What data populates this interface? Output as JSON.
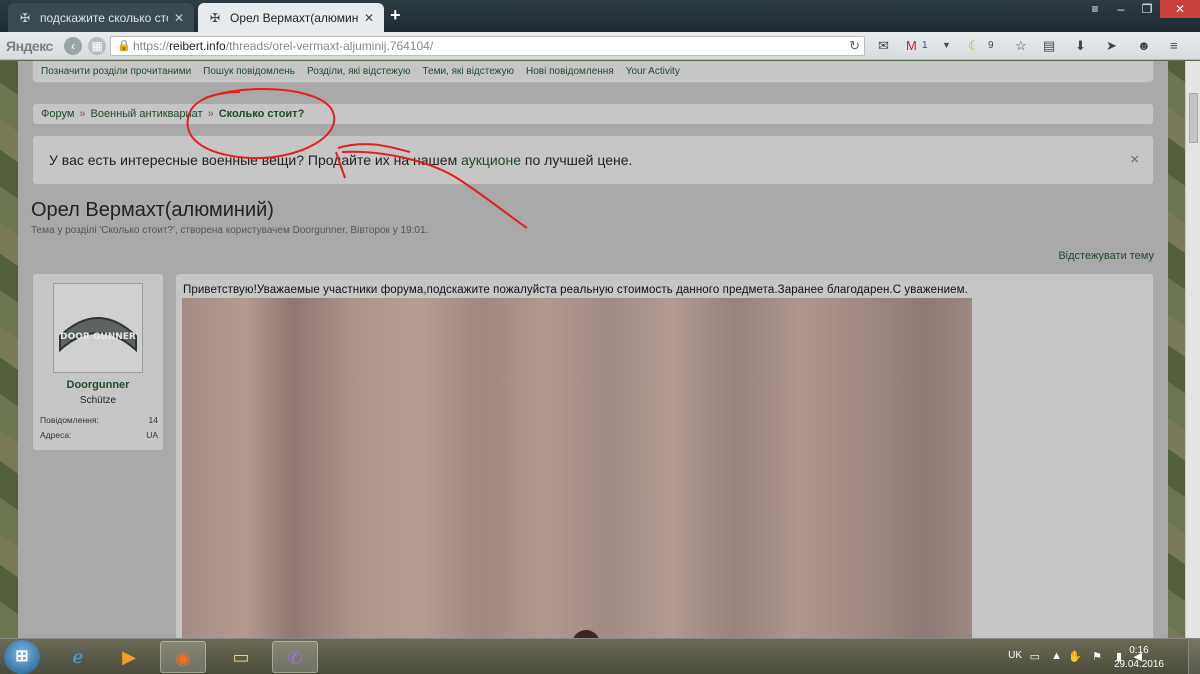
{
  "browser": {
    "tabs": [
      {
        "title": "подскажите сколько стои…",
        "active": false
      },
      {
        "title": "Орел Вермахт(алюминий…",
        "active": true
      }
    ],
    "brand": "Яндекс",
    "url_prefix": "https://",
    "url_host": "reibert.info",
    "url_path": "/threads/orel-vermaxt-aljuminij.764104/",
    "toolbar_mail_count": "1",
    "toolbar_weather_count": "9"
  },
  "site": {
    "subnav": [
      "Позначити розділи прочитаними",
      "Пошук повідомлень",
      "Розділи, які відстежую",
      "Теми, які відстежую",
      "Нові повідомлення",
      "Your Activity"
    ],
    "breadcrumbs": [
      "Форум",
      "Военный антиквариат",
      "Сколько стоит?"
    ],
    "breadcrumb_sep": "»",
    "notice": {
      "before": "У вас есть интересные военные вещи? Продайте их на нашем ",
      "link": "аукционе",
      "after": " по лучшей цене.",
      "close": "×"
    },
    "thread": {
      "title": "Орел Вермахт(алюминий)",
      "meta": "Тема у розділі 'Сколько стоит?', створена користувачем Doorgunner, Вівторок у 19:01.",
      "watch": "Відстежувати тему"
    },
    "user": {
      "avatar_text": "DOOR GUNNER",
      "name": "Doorgunner",
      "rank": "Schütze",
      "posts_label": "Повідомлення:",
      "posts_value": "14",
      "location_label": "Адреса:",
      "location_value": "UA"
    },
    "post": {
      "text": "Приветствую!Уважаемые участники форума,подскажите пожалуйста реальную стоимость данного предмета.Заранее благодарен.С уважением."
    }
  },
  "taskbar": {
    "lang": "UK",
    "time": "0:16",
    "date": "29.04.2016"
  },
  "colors": {
    "annotation": "#e02020",
    "link": "#1f4a2b"
  }
}
